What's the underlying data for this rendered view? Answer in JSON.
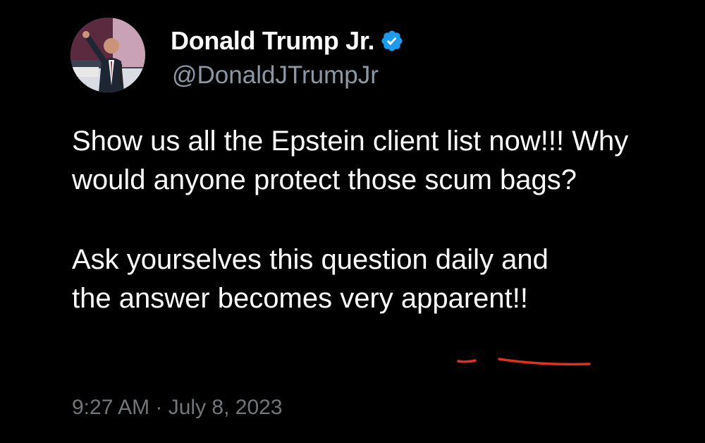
{
  "author": {
    "display_name": "Donald Trump Jr.",
    "handle": "@DonaldJTrumpJr",
    "verified_icon": "verified-badge-icon",
    "badge_color": "#1d9bf0"
  },
  "tweet": {
    "paragraph_1": "Show us all the Epstein client list now!!! Why would anyone protect those scum bags?",
    "paragraph_2_line_1": "Ask yourselves this question daily and",
    "paragraph_2_line_2_prefix": "the answer becomes very ",
    "paragraph_2_underlined_word": "apparent",
    "paragraph_2_suffix": "!!",
    "annotation_color": "#e0301e"
  },
  "meta": {
    "timestamp": "9:27 AM · July 8, 2023"
  },
  "colors": {
    "background": "#000000",
    "primary_text": "#ffffff",
    "secondary_text": "#8b98a5",
    "timestamp_text": "#71767b"
  }
}
